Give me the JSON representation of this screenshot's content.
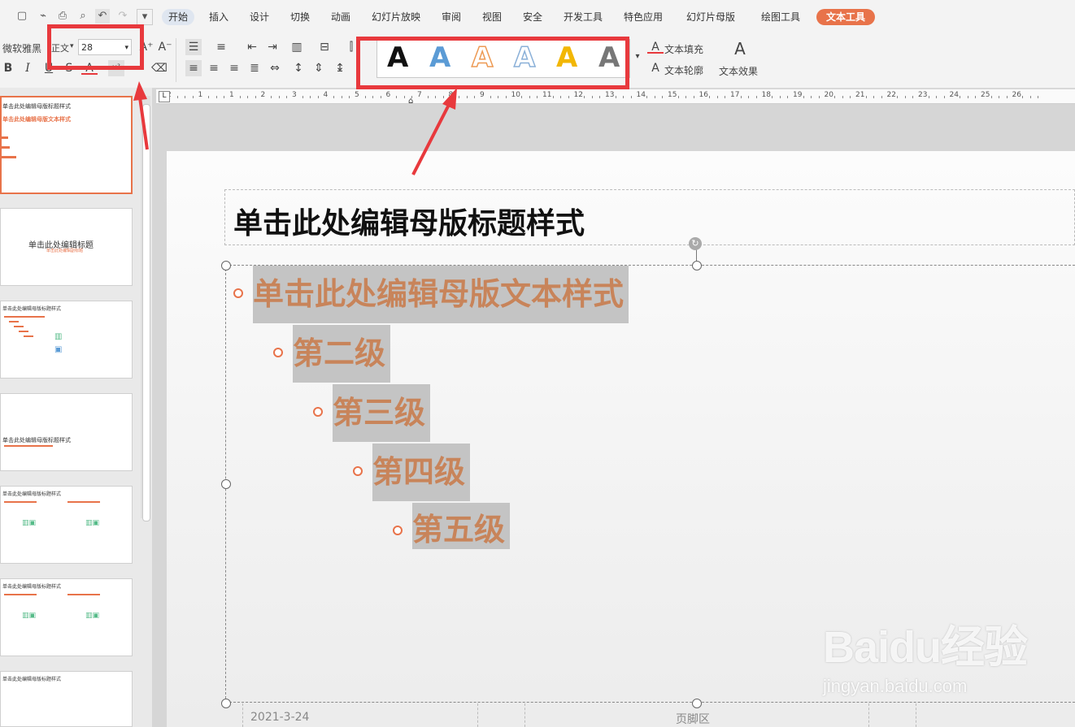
{
  "menu": {
    "tabs": [
      "开始",
      "插入",
      "设计",
      "切换",
      "动画",
      "幻灯片放映",
      "审阅",
      "视图",
      "安全",
      "开发工具",
      "特色应用",
      "幻灯片母版",
      "绘图工具",
      "文本工具"
    ],
    "active_tab": "开始",
    "highlight_tab": "文本工具"
  },
  "ribbon": {
    "font_name": "微软雅黑",
    "font_script": "正文",
    "font_size": "28",
    "text_styles": [
      {
        "letter": "A",
        "color": "#111111",
        "style": "solid"
      },
      {
        "letter": "A",
        "color": "#5b9bd5",
        "style": "solid"
      },
      {
        "letter": "A",
        "color": "#ed9a54",
        "style": "outline"
      },
      {
        "letter": "A",
        "color": "#8ab0d8",
        "style": "outline"
      },
      {
        "letter": "A",
        "color": "#f2b705",
        "style": "solid"
      },
      {
        "letter": "A",
        "color": "#777777",
        "style": "solid"
      }
    ],
    "text_fill": "文本填充",
    "text_outline": "文本轮廓",
    "text_effect": "文本效果"
  },
  "ruler": {
    "labels": [
      "2",
      "1",
      "1",
      "2",
      "3",
      "4",
      "5",
      "6",
      "7",
      "8",
      "9",
      "10",
      "11",
      "12",
      "13",
      "14",
      "15",
      "16",
      "17",
      "18",
      "19",
      "20",
      "21",
      "22",
      "23",
      "24",
      "25",
      "26"
    ]
  },
  "thumbnails": [
    {
      "title": "单击此处编辑母版标题样式",
      "text": "单击此处编辑母版文本样式"
    },
    {
      "title": "单击此处编辑标题",
      "text": "单击此处编辑副标题"
    },
    {
      "title": "单击此处编辑母版标题样式",
      "text": ""
    },
    {
      "title": "单击此处编辑母版标题样式",
      "text": ""
    },
    {
      "title": "单击此处编辑母版标题样式",
      "text": ""
    },
    {
      "title": "单击此处编辑母版标题样式",
      "text": ""
    },
    {
      "title": "单击此处编辑母版标题样式",
      "text": ""
    }
  ],
  "slide": {
    "title": "单击此处编辑母版标题样式",
    "levels": [
      "单击此处编辑母版文本样式",
      "第二级",
      "第三级",
      "第四级",
      "第五级"
    ],
    "footer_date": "2021-3-24",
    "footer_text": "页脚区"
  },
  "watermark": {
    "brand": "Baidu经验",
    "url": "jingyan.baidu.com"
  },
  "colors": {
    "accent": "#e8734a",
    "annotation_red": "#e8393d",
    "level_text": "#c8845a"
  }
}
